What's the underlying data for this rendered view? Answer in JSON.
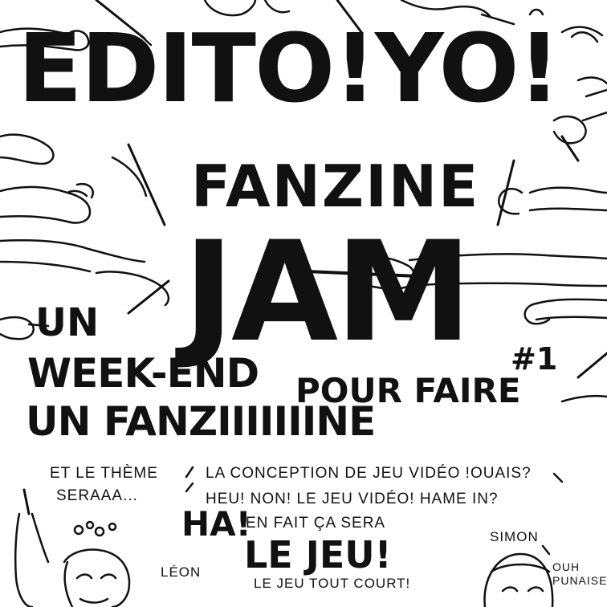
{
  "poster": {
    "title": "EDITO!YO!",
    "subtitle": "FANZINE",
    "jam": "JAM",
    "edition": "#1",
    "tagline": {
      "line1": "UN",
      "line2": "WEEK-END",
      "line3": "POUR FAIRE",
      "line4": "UN FANZIIIIIIINE"
    }
  },
  "dialogue": {
    "left_line1": "ET LE THÈME",
    "left_line2": "SERAAA...",
    "right_line1": "LA CONCEPTION DE JEU VIDÉO !OUAIS?",
    "right_line2": "HEU! NON! LE JEU VIDÉO! HAME IN?",
    "exclaim": "HA!",
    "right_line3": "EN FAIT ÇA SERA",
    "punchline": "LE JEU!",
    "footer": "LE JEU TOUT COURT!",
    "simon_reply": "OUH PUNAISE"
  },
  "characters": {
    "leon": "LÉON",
    "simon": "SIMON"
  },
  "colors": {
    "ink": "#111111",
    "paper": "#ffffff"
  }
}
